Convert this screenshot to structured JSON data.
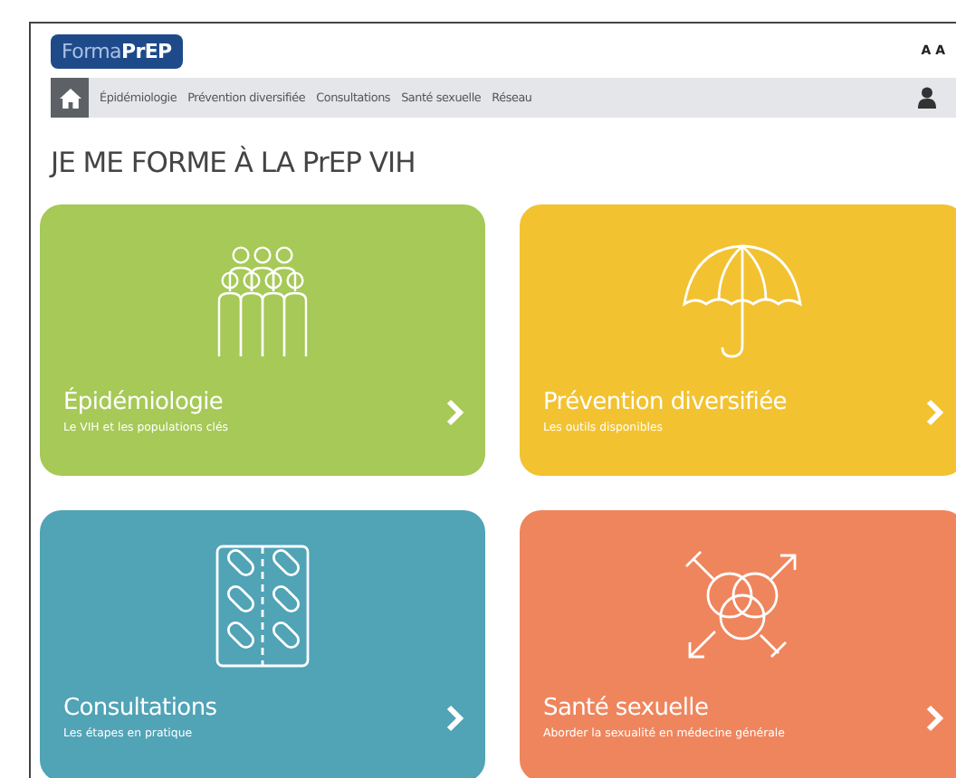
{
  "header": {
    "logo": {
      "light": "Forma",
      "bold": "PrEP"
    },
    "font_size_toggle": "A A"
  },
  "nav": {
    "items": [
      "Épidémiologie",
      "Prévention diversifiée",
      "Consultations",
      "Santé sexuelle",
      "Réseau"
    ]
  },
  "title": "JE ME FORME À LA PrEP VIH",
  "cards": [
    {
      "title": "Épidémiologie",
      "subtitle": "Le VIH et les populations clés",
      "color": "#a6c957",
      "kind": "people"
    },
    {
      "title": "Prévention diversifiée",
      "subtitle": "Les outils disponibles",
      "color": "#f2c231",
      "kind": "umbrella"
    },
    {
      "title": "Consultations",
      "subtitle": "Les étapes en pratique",
      "color": "#51a3b6",
      "kind": "pills"
    },
    {
      "title": "Santé sexuelle",
      "subtitle": "Aborder la sexualité en médecine générale",
      "color": "#ef855d",
      "kind": "gender"
    }
  ]
}
